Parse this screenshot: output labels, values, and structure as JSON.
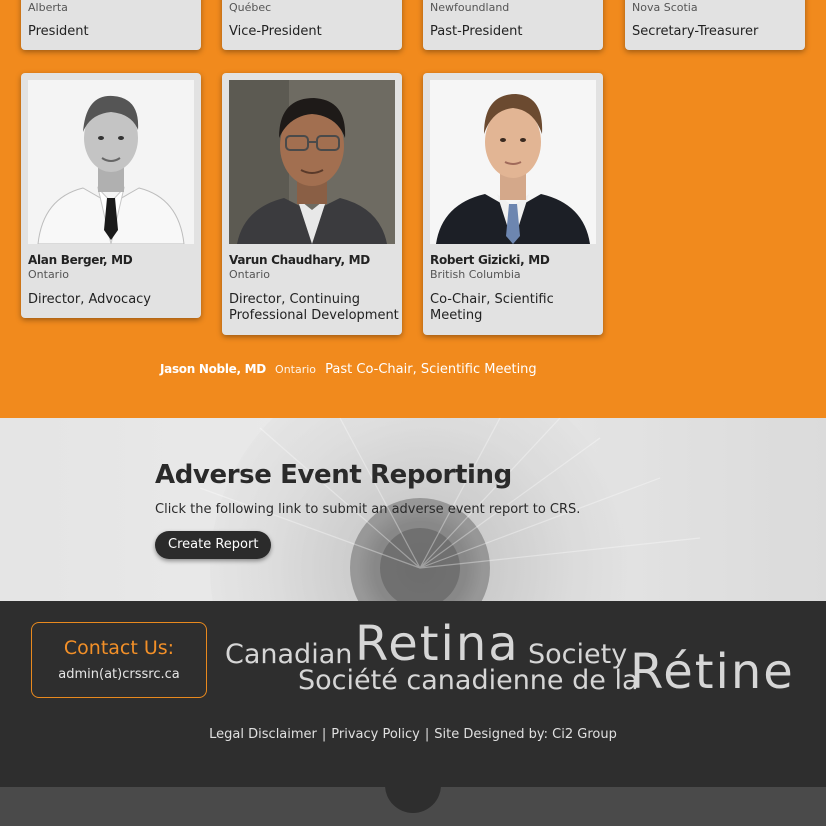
{
  "board": {
    "top_row": [
      {
        "province": "Alberta",
        "role": "President"
      },
      {
        "province": "Québec",
        "role": "Vice-President"
      },
      {
        "province": "Newfoundland",
        "role": "Past-President"
      },
      {
        "province": "Nova Scotia",
        "role": "Secretary-Treasurer"
      }
    ],
    "members": [
      {
        "name": "Alan Berger, MD",
        "province": "Ontario",
        "role": "Director, Advocacy"
      },
      {
        "name": "Varun Chaudhary, MD",
        "province": "Ontario",
        "role_line1": "Director, Continuing",
        "role_line2": "Professional Development"
      },
      {
        "name": "Robert Gizicki, MD",
        "province": "British Columbia",
        "role_line1": "Co-Chair, Scientific",
        "role_line2": "Meeting"
      }
    ],
    "extra": {
      "name": "Jason Noble, MD",
      "province": "Ontario",
      "role": "Past Co-Chair, Scientific Meeting"
    }
  },
  "adverse": {
    "title": "Adverse Event Reporting",
    "text": "Click the following link to submit an adverse event report to CRS.",
    "button": "Create Report"
  },
  "footer": {
    "contact_title": "Contact Us:",
    "contact_email": "admin(at)crssrc.ca",
    "logo_line1_a": "Canadian",
    "logo_line1_b": "Retina",
    "logo_line1_c": "Society",
    "logo_line2_a": "Société canadienne de la",
    "logo_line2_b": "Rétine",
    "links": [
      "Legal Disclaimer",
      "Privacy Policy",
      "Site Designed by: Ci2 Group"
    ]
  },
  "colors": {
    "orange": "#f18a1d",
    "dark": "#2e2e2e",
    "card": "#e2e2e2"
  }
}
